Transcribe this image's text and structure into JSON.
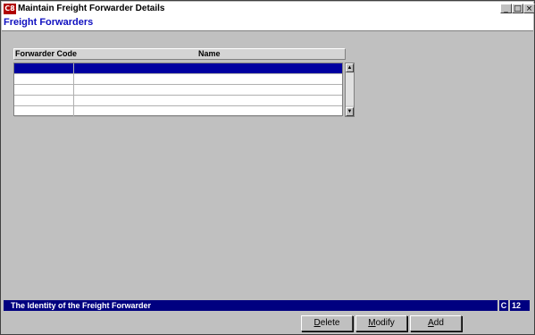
{
  "window": {
    "title": "Maintain Freight Forwarder Details",
    "icon_label": "C8",
    "buttons": {
      "minimize": "_",
      "maximize": "□",
      "close": "×"
    }
  },
  "screen": {
    "title": "Freight Forwarders"
  },
  "grid": {
    "columns": [
      "Forwarder Code",
      "Name"
    ],
    "rows": [
      {
        "code": "",
        "name": "",
        "selected": true
      },
      {
        "code": "",
        "name": "",
        "selected": false
      },
      {
        "code": "",
        "name": "",
        "selected": false
      },
      {
        "code": "",
        "name": "",
        "selected": false
      },
      {
        "code": "",
        "name": "",
        "selected": false
      }
    ]
  },
  "scrollbar": {
    "up": "▲",
    "down": "▼"
  },
  "status": {
    "message": "The Identity of the Freight Forwarder",
    "mode": "C",
    "count": "12"
  },
  "actions": {
    "delete_accel": "D",
    "delete_rest": "elete",
    "modify_accel": "M",
    "modify_rest": "odify",
    "add_accel": "A",
    "add_rest": "dd"
  },
  "colors": {
    "selection": "#0000a0",
    "status_bg": "#000080",
    "screen_title": "#1010c0"
  }
}
